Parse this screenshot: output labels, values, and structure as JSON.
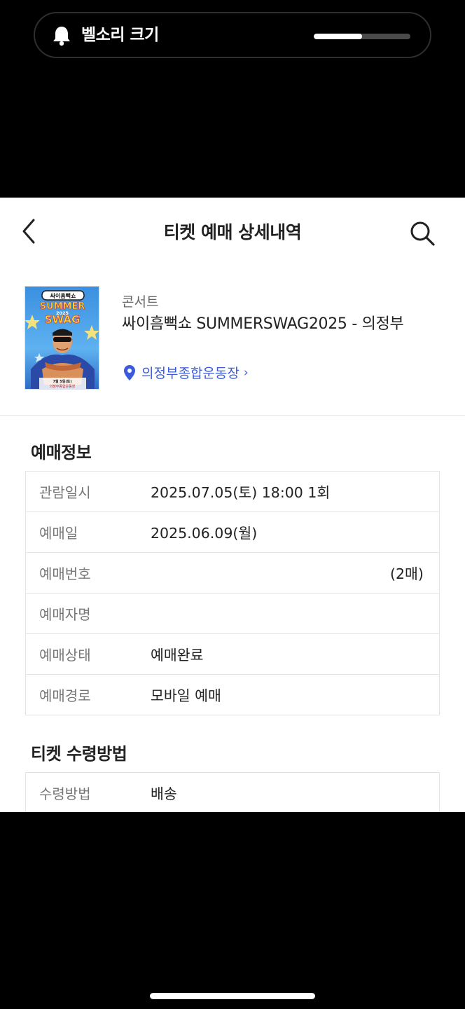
{
  "hud": {
    "label": "벨소리 크기",
    "icon": "bell-icon",
    "level": 0.5
  },
  "header": {
    "title": "티켓 예매 상세내역",
    "back_icon": "chevron-left-icon",
    "search_icon": "search-icon"
  },
  "event": {
    "poster_text": {
      "badge": "싸이흠뻑쇼",
      "line1": "SUMMER",
      "year": "2025",
      "line2": "SWAG",
      "date": "7월 5일(토)",
      "place": "의정부종합운동장"
    },
    "category": "콘서트",
    "title": "싸이흠뻑쇼 SUMMERSWAG2025 - 의정부",
    "venue": "의정부종합운동장",
    "venue_arrow": "›",
    "venue_icon": "location-pin-icon"
  },
  "booking_info": {
    "title": "예매정보",
    "rows": [
      {
        "label": "관람일시",
        "value": "2025.07.05(토) 18:00 1회"
      },
      {
        "label": "예매일",
        "value": "2025.06.09(월)"
      },
      {
        "label": "예매번호",
        "value": "",
        "suffix": "(2매)"
      },
      {
        "label": "예매자명",
        "value": ""
      },
      {
        "label": "예매상태",
        "value": "예매완료"
      },
      {
        "label": "예매경로",
        "value": "모바일 예매"
      }
    ]
  },
  "delivery": {
    "title": "티켓 수령방법",
    "rows": [
      {
        "label": "수령방법",
        "value": "배송"
      }
    ]
  },
  "colors": {
    "accent": "#3b5bdb",
    "text": "#222222",
    "label": "#777777",
    "border": "#e3e3e3"
  }
}
